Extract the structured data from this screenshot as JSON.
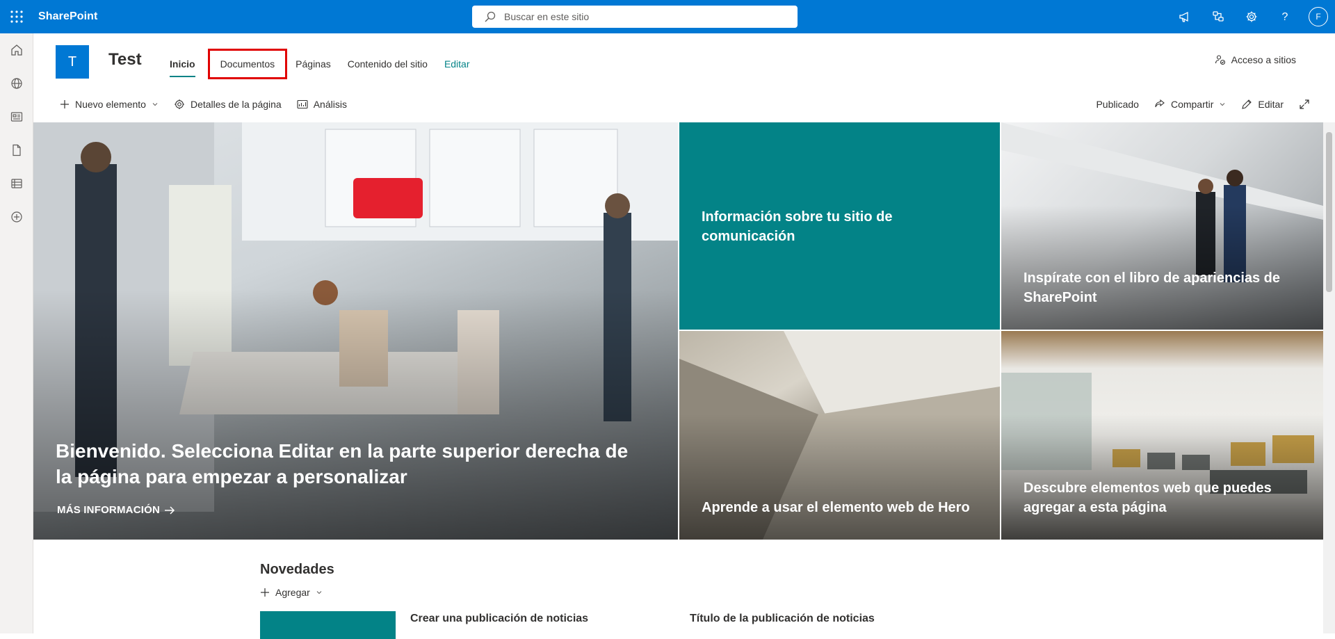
{
  "suite_bar": {
    "brand": "SharePoint",
    "search_placeholder": "Buscar en este sitio",
    "avatar_initial": "F",
    "icons": [
      "waffle-icon",
      "search-icon",
      "megaphone-icon",
      "share-network-icon",
      "settings-icon",
      "help-icon"
    ]
  },
  "app_bar": {
    "icons": [
      "home-icon",
      "globe-icon",
      "news-icon",
      "document-icon",
      "list-icon",
      "add-icon"
    ]
  },
  "site": {
    "logo_letter": "T",
    "title": "Test",
    "nav": [
      {
        "label": "Inicio"
      },
      {
        "label": "Documentos"
      },
      {
        "label": "Páginas"
      },
      {
        "label": "Contenido del sitio"
      },
      {
        "label": "Editar"
      }
    ],
    "access_label": "Acceso a sitios"
  },
  "command_bar": {
    "new_label": "Nuevo elemento",
    "details_label": "Detalles de la página",
    "analytics_label": "Análisis",
    "status_label": "Publicado",
    "share_label": "Compartir",
    "edit_label": "Editar"
  },
  "hero": {
    "main_text": "Bienvenido. Selecciona Editar en la parte superior derecha de la página para empezar a personalizar",
    "main_link": "MÁS INFORMACIÓN",
    "tile2": "Información sobre tu sitio de comunicación",
    "tile3": "Inspírate con el libro de apariencias de SharePoint",
    "tile4": "Aprende a usar el elemento web de Hero",
    "tile5": "Descubre elementos web que puedes agregar a esta página"
  },
  "news": {
    "title": "Novedades",
    "add_label": "Agregar",
    "item1": "Crear una publicación de noticias",
    "item2": "Título de la publicación de noticias"
  },
  "colors": {
    "suite_bar": "#0078d4",
    "teal_accent": "#038387",
    "highlight_box": "#e00000"
  }
}
